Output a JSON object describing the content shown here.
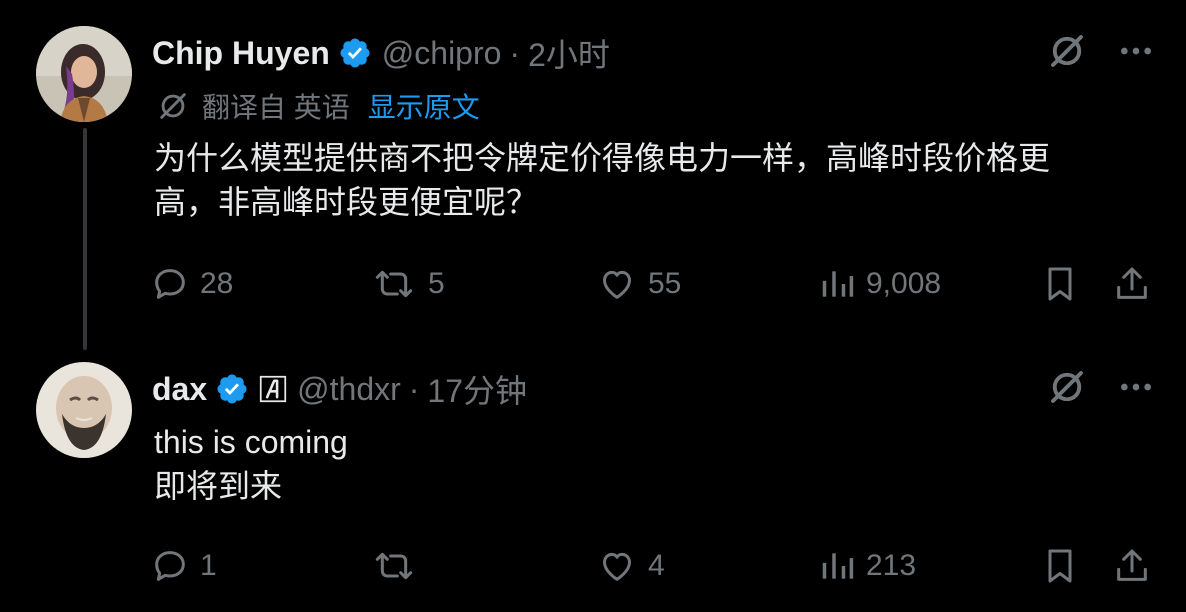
{
  "tweets": [
    {
      "author": "Chip Huyen",
      "handle": "@chipro",
      "separator": "·",
      "time": "2小时",
      "translate_label": "翻译自 英语",
      "show_original": "显示原文",
      "text_line1": "为什么模型提供商不把令牌定价得像电力一样，高峰时段价格更",
      "text_line2": "高，非高峰时段更便宜呢？",
      "replies": "28",
      "retweets": "5",
      "likes": "55",
      "views": "9,008"
    },
    {
      "author": "dax",
      "handle": "@thdxr",
      "separator": "·",
      "time": "17分钟",
      "text_line1": "this is coming",
      "text_line2": "即将到来",
      "replies": "1",
      "retweets": "",
      "likes": "4",
      "views": "213"
    }
  ],
  "colors": {
    "background": "#000000",
    "text": "#e7e9ea",
    "muted": "#71767b",
    "accent": "#1d9bf0"
  },
  "icons": [
    "verified-badge-icon",
    "grok-icon",
    "more-icon",
    "translate-icon",
    "reply-icon",
    "retweet-icon",
    "like-icon",
    "views-icon",
    "bookmark-icon",
    "share-icon",
    "affiliate-badge-icon"
  ]
}
